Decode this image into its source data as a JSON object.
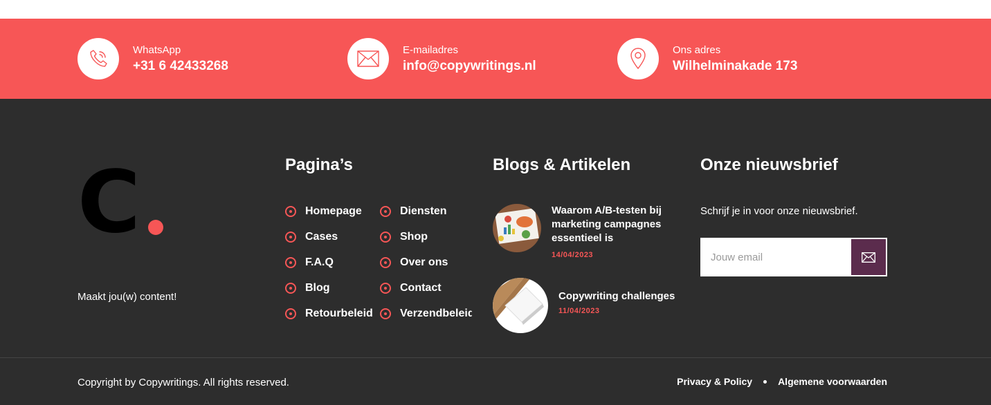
{
  "contact_bar": {
    "items": [
      {
        "icon": "phone-icon",
        "label": "WhatsApp",
        "value": "+31 6 42433268"
      },
      {
        "icon": "mail-icon",
        "label": "E-mailadres",
        "value": "info@copywritings.nl"
      },
      {
        "icon": "location-pin-icon",
        "label": "Ons adres",
        "value": "Wilhelminakade 173"
      }
    ]
  },
  "brand": {
    "logo_letter": "C",
    "tagline": "Maakt jou(w) content!"
  },
  "pages": {
    "title": "Pagina’s",
    "left": [
      "Homepage",
      "Cases",
      "F.A.Q",
      "Blog",
      "Retourbeleid"
    ],
    "right": [
      "Diensten",
      "Shop",
      "Over ons",
      "Contact",
      "Verzendbeleid"
    ]
  },
  "blogs": {
    "title": "Blogs & Artikelen",
    "items": [
      {
        "title": "Waarom A/B-testen bij marketing campagnes essentieel is",
        "date": "14/04/2023"
      },
      {
        "title": "Copywriting challenges",
        "date": "11/04/2023"
      }
    ]
  },
  "newsletter": {
    "title": "Onze nieuwsbrief",
    "text": "Schrijf je in voor onze nieuwsbrief.",
    "placeholder": "Jouw email"
  },
  "bottom": {
    "copyright": "Copyright by Copywritings. All rights reserved.",
    "links": [
      "Privacy & Policy",
      "Algemene voorwaarden"
    ]
  },
  "colors": {
    "accent": "#f75656",
    "footer_bg": "#2d2d2d",
    "button_bg": "#5b2c4d"
  }
}
